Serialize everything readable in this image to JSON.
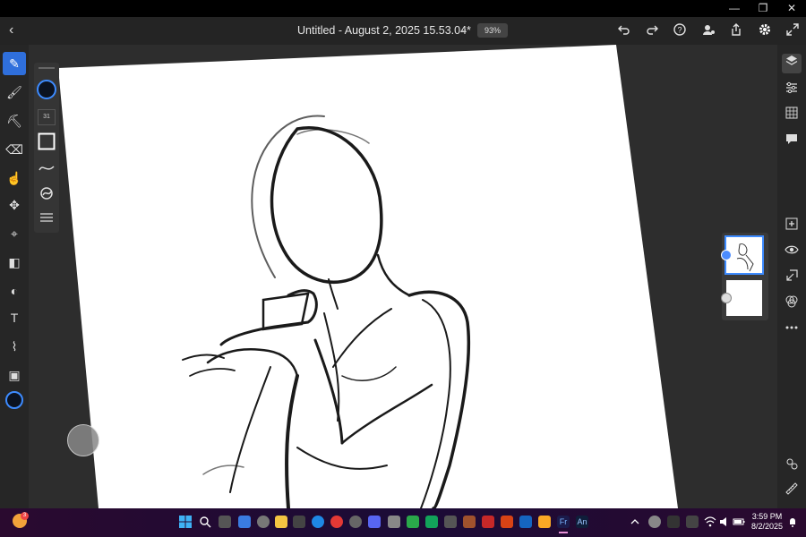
{
  "window": {
    "minimize_glyph": "—",
    "restore_glyph": "❐",
    "close_glyph": "✕"
  },
  "app": {
    "back_glyph": "‹",
    "title": "Untitled - August 2, 2025 15.53.04*",
    "title_dropdown_glyph": "⌄",
    "zoom": "93%"
  },
  "toolbar_icons": {
    "undo": "undo-icon",
    "redo": "redo-icon",
    "help": "help-icon",
    "share": "share-icon",
    "export": "export-icon",
    "settings": "gear-icon",
    "fullscreen": "expand-icon"
  },
  "tools": [
    {
      "name": "brush-tool",
      "glyph": "✎",
      "active": true
    },
    {
      "name": "paint-tool",
      "glyph": "🖌"
    },
    {
      "name": "fill-brush-tool",
      "glyph": "⛏"
    },
    {
      "name": "eraser-tool",
      "glyph": "⌫"
    },
    {
      "name": "smudge-tool",
      "glyph": "☝"
    },
    {
      "name": "transform-tool",
      "glyph": "✥"
    },
    {
      "name": "lasso-tool",
      "glyph": "⌖"
    },
    {
      "name": "fill-tool",
      "glyph": "◧"
    },
    {
      "name": "shape-tool",
      "glyph": "◐"
    },
    {
      "name": "text-tool",
      "glyph": "T"
    },
    {
      "name": "eyedropper-tool",
      "glyph": "⌇"
    },
    {
      "name": "image-tool",
      "glyph": "▣"
    }
  ],
  "brush_panel": {
    "size_value": "31"
  },
  "colors": {
    "accent": "#2f6fdc",
    "current_color": "#0b1220",
    "canvas_bg": "#ffffff",
    "workspace_bg": "#2d2d2d"
  },
  "right_tools": [
    "layers-icon",
    "adjustments-icon",
    "grid-icon",
    "comment-icon",
    "add-layer-icon",
    "visibility-icon",
    "import-icon",
    "blend-icon",
    "more-icon",
    "touch-shortcut-icon",
    "ruler-icon"
  ],
  "taskbar": {
    "time": "3:59 PM",
    "date": "8/2/2025",
    "notification_badge": "3",
    "fr_label": "Fr",
    "an_label": "An"
  }
}
